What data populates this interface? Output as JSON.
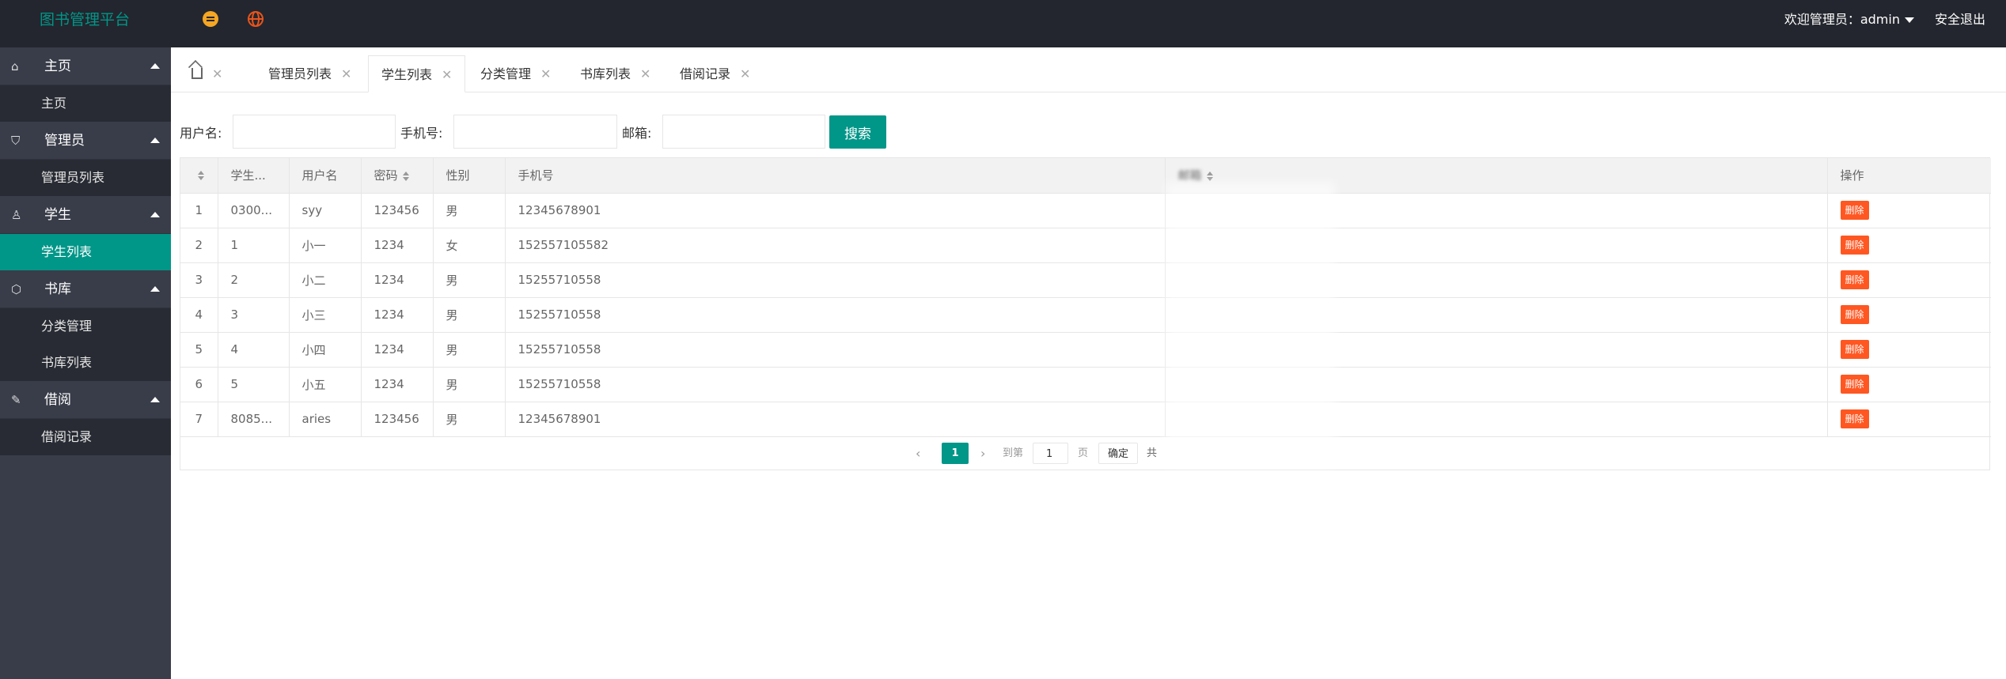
{
  "header": {
    "app_title": "图书管理平台",
    "welcome": "欢迎管理员：admin",
    "logout": "安全退出",
    "icons": [
      "menu-icon",
      "globe-icon"
    ]
  },
  "sidebar": {
    "groups": [
      {
        "label": "主页",
        "icon": "home-icon",
        "items": [
          "主页"
        ]
      },
      {
        "label": "管理员",
        "icon": "shield-icon",
        "items": [
          "管理员列表"
        ]
      },
      {
        "label": "学生",
        "icon": "user-icon",
        "items": [
          "学生列表"
        ]
      },
      {
        "label": "书库",
        "icon": "box-icon",
        "items": [
          "分类管理",
          "书库列表"
        ]
      },
      {
        "label": "借阅",
        "icon": "edit-icon",
        "items": [
          "借阅记录"
        ]
      }
    ],
    "active_item": "学生列表"
  },
  "tabs": [
    "管理员列表",
    "学生列表",
    "分类管理",
    "书库列表",
    "借阅记录"
  ],
  "active_tab": "学生列表",
  "search": {
    "username_label": "用户名:",
    "phone_label": "手机号:",
    "email_label": "邮箱:",
    "username_value": "",
    "phone_value": "",
    "email_value": "",
    "button": "搜索"
  },
  "table": {
    "columns": [
      "学生...",
      "用户名",
      "密码",
      "性别",
      "手机号",
      "邮箱",
      "操作"
    ],
    "rows": [
      {
        "idx": "1",
        "sid": "0300...",
        "username": "syy",
        "password": "123456",
        "gender": "男",
        "phone": "12345678901",
        "email": " ",
        "action": "删除"
      },
      {
        "idx": "2",
        "sid": "1",
        "username": "小一",
        "password": "1234",
        "gender": "女",
        "phone": "152557105582",
        "email": " ",
        "action": "删除"
      },
      {
        "idx": "3",
        "sid": "2",
        "username": "小二",
        "password": "1234",
        "gender": "男",
        "phone": "15255710558",
        "email": " ",
        "action": "删除"
      },
      {
        "idx": "4",
        "sid": "3",
        "username": "小三",
        "password": "1234",
        "gender": "男",
        "phone": "15255710558",
        "email": " ",
        "action": "删除"
      },
      {
        "idx": "5",
        "sid": "4",
        "username": "小四",
        "password": "1234",
        "gender": "男",
        "phone": "15255710558",
        "email": " ",
        "action": "删除"
      },
      {
        "idx": "6",
        "sid": "5",
        "username": "小五",
        "password": "1234",
        "gender": "男",
        "phone": "15255710558",
        "email": " ",
        "action": "删除"
      },
      {
        "idx": "7",
        "sid": "8085...",
        "username": "aries",
        "password": "123456",
        "gender": "男",
        "phone": "12345678901",
        "email": " ",
        "action": "删除"
      }
    ]
  },
  "pagination": {
    "current": "1",
    "goto_label": "到第",
    "goto_value": "1",
    "page_unit": "页",
    "confirm": "确定",
    "total_prefix": "共"
  },
  "colors": {
    "header_bg": "#23262e",
    "sidebar_bg": "#393d49",
    "accent": "#009688",
    "danger": "#ff5722"
  }
}
